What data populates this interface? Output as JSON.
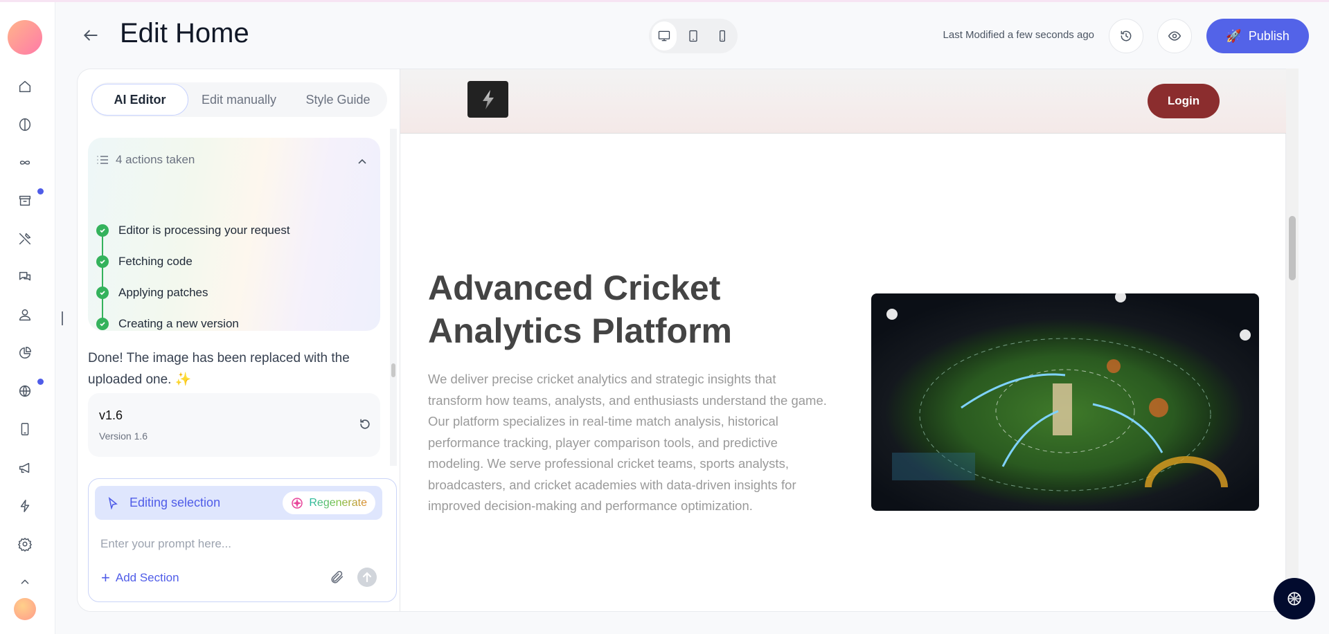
{
  "header": {
    "title": "Edit Home",
    "last_modified": "Last Modified a few seconds ago",
    "publish_label": "Publish",
    "devices": [
      "desktop-icon",
      "tablet-icon",
      "mobile-icon"
    ],
    "active_device": "desktop"
  },
  "sidebar": {
    "items": [
      "home-icon",
      "brain-icon",
      "infinity-icon",
      "archive-icon",
      "tools-icon",
      "chat-icon",
      "user-icon",
      "pie-chart-icon",
      "globe-icon",
      "mobile-icon",
      "megaphone-icon",
      "lightning-icon",
      "settings-icon",
      "chevron-up-icon"
    ],
    "badges": [
      "archive",
      "globe"
    ]
  },
  "panel": {
    "tabs": [
      {
        "label": "AI Editor",
        "active": true
      },
      {
        "label": "Edit manually"
      },
      {
        "label": "Style Guide"
      }
    ],
    "actions": {
      "title": "4 actions taken",
      "steps": [
        "Editor is processing your request",
        "Fetching code",
        "Applying patches",
        "Creating a new version"
      ]
    },
    "message": "Done! The image has been replaced with the uploaded one. ✨",
    "version": {
      "name": "v1.6",
      "subtitle": "Version 1.6"
    },
    "composer": {
      "selection_label": "Editing selection",
      "regenerate_label": "Regenerate",
      "placeholder": "Enter your prompt here...",
      "value": "",
      "add_section_label": "Add Section"
    }
  },
  "preview": {
    "login_label": "Login",
    "hero_title": "Advanced Cricket Analytics Platform",
    "hero_text": "We deliver precise cricket analytics and strategic insights that transform how teams, analysts, and enthusiasts understand the game. Our platform specializes in real-time match analysis, historical performance tracking, player comparison tools, and predictive modeling. We serve professional cricket teams, sports analysts, broadcasters, and cricket academies with data-driven insights for improved decision-making and performance optimization."
  },
  "colors": {
    "accent": "#5363e8",
    "login": "#8b2d2e",
    "success": "#34b25c",
    "fab": "#020b2e"
  }
}
